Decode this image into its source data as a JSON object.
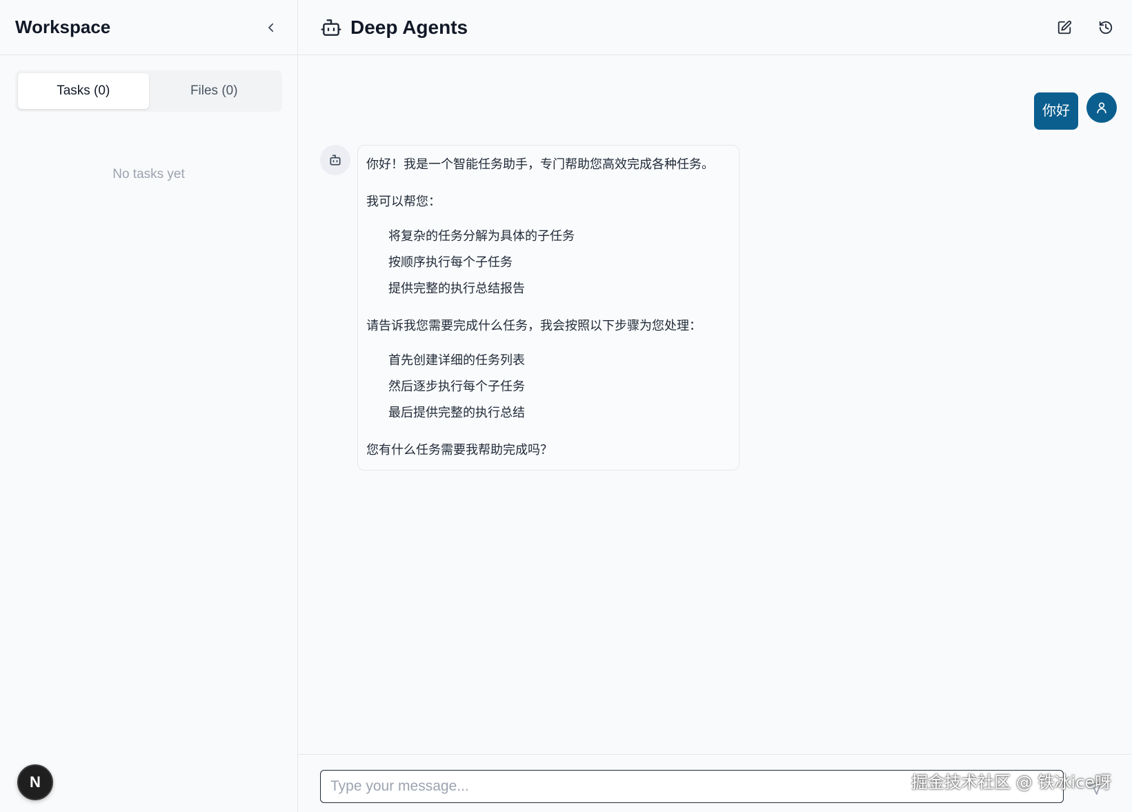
{
  "sidebar": {
    "title": "Workspace",
    "tabs": [
      {
        "label": "Tasks (0)",
        "active": true
      },
      {
        "label": "Files (0)",
        "active": false
      }
    ],
    "empty_text": "No tasks yet",
    "badge_letter": "N"
  },
  "header": {
    "title": "Deep Agents",
    "icons": [
      "robot-icon",
      "edit-icon",
      "history-icon"
    ]
  },
  "messages": {
    "user": {
      "text": "你好"
    },
    "bot": {
      "intro": "你好！我是一个智能任务助手，专门帮助您高效完成各种任务。",
      "can_help": "我可以帮您：",
      "help_items": [
        "将复杂的任务分解为具体的子任务",
        "按顺序执行每个子任务",
        "提供完整的执行总结报告"
      ],
      "steps_intro": "请告诉我您需要完成什么任务，我会按照以下步骤为您处理：",
      "steps": [
        "首先创建详细的任务列表",
        "然后逐步执行每个子任务",
        "最后提供完整的执行总结"
      ],
      "closing": "您有什么任务需要我帮助完成吗？"
    }
  },
  "composer": {
    "placeholder": "Type your message...",
    "value": ""
  },
  "watermark": "掘金技术社区 @ 铁冰ice呀",
  "colors": {
    "accent": "#0b5f8f",
    "background": "#f9fafb",
    "border": "#e5e7eb"
  }
}
